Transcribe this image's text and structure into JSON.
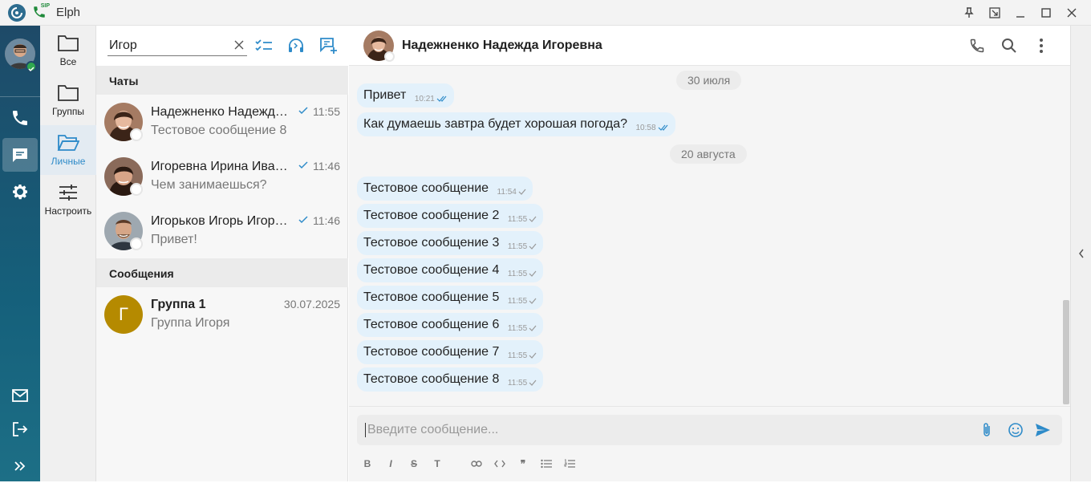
{
  "app": {
    "title": "Elph",
    "sip_badge": "SIP"
  },
  "folders": [
    {
      "label": "Все",
      "icon": "folder-icon"
    },
    {
      "label": "Группы",
      "icon": "folder-icon"
    },
    {
      "label": "Личные",
      "icon": "folder-open-icon",
      "active": true
    },
    {
      "label": "Настроить",
      "icon": "sliders-icon"
    }
  ],
  "search": {
    "value": "Игор"
  },
  "sections": {
    "chats": "Чаты",
    "messages": "Сообщения"
  },
  "chats": [
    {
      "name": "Надежненко Надежда Игоревна",
      "time": "11:55",
      "preview": "Тестовое сообщение 8"
    },
    {
      "name": "Игоревна Ирина Ивановна",
      "time": "11:46",
      "preview": "Чем занимаешься?"
    },
    {
      "name": "Игорьков Игорь Игоревич",
      "time": "11:46",
      "preview": "Привет!"
    }
  ],
  "message_results": [
    {
      "initial": "Г",
      "name": "Группа 1",
      "date": "30.07.2025",
      "preview": "Группа Игоря"
    }
  ],
  "conversation": {
    "contact_name": "Надежненко Надежда Игоревна",
    "dates": [
      "30 июля",
      "20 августа"
    ],
    "messages": [
      {
        "text": "Привет",
        "time": "10:21",
        "read": true
      },
      {
        "text": "Как думаешь завтра будет хорошая погода?",
        "time": "10:58",
        "read": true
      },
      {
        "text": "Тестовое сообщение",
        "time": "11:54",
        "read": false
      },
      {
        "text": "Тестовое сообщение 2",
        "time": "11:55",
        "read": false
      },
      {
        "text": "Тестовое сообщение 3",
        "time": "11:55",
        "read": false
      },
      {
        "text": "Тестовое сообщение 4",
        "time": "11:55",
        "read": false
      },
      {
        "text": "Тестовое сообщение 5",
        "time": "11:55",
        "read": false
      },
      {
        "text": "Тестовое сообщение 6",
        "time": "11:55",
        "read": false
      },
      {
        "text": "Тестовое сообщение 7",
        "time": "11:55",
        "read": false
      },
      {
        "text": "Тестовое сообщение 8",
        "time": "11:55",
        "read": false
      }
    ]
  },
  "composer": {
    "placeholder": "Введите сообщение...",
    "format_bold": "B",
    "format_italic": "I",
    "format_strike": "S",
    "format_text": "T",
    "format_quote": "❞"
  },
  "colors": {
    "accent": "#2e8bc9",
    "bubble": "#e3f1fb",
    "rail_top": "#1e4a68",
    "rail_bottom": "#1d6f86",
    "online": "#2fa84f",
    "group_avatar": "#b58a00"
  }
}
